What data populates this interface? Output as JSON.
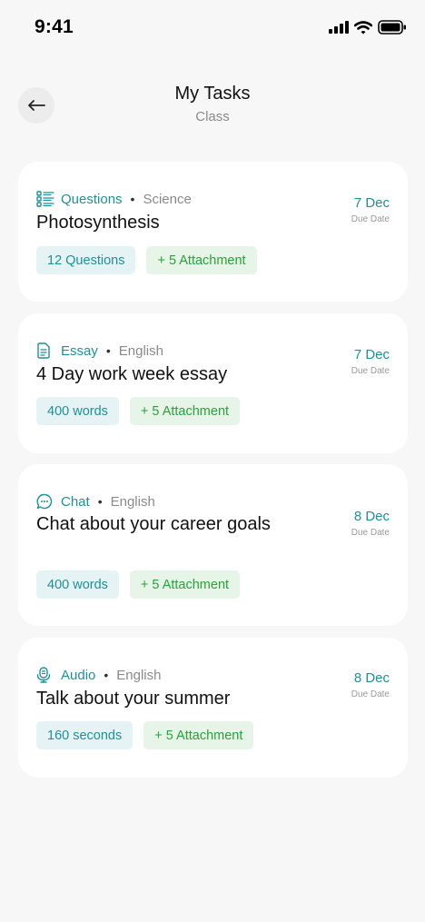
{
  "status_bar": {
    "time": "9:41"
  },
  "header": {
    "title": "My Tasks",
    "subtitle": "Class",
    "back_icon": "arrow-left-icon"
  },
  "colors": {
    "accent": "#1f8f99",
    "green": "#2aa13b",
    "muted": "#8a8a8a"
  },
  "tasks": [
    {
      "icon": "checklist-icon",
      "type": "Questions",
      "subject": "Science",
      "title": "Photosynthesis",
      "due_date": "7 Dec",
      "due_label": "Due Date",
      "count": "12 Questions",
      "attachments": "+ 5 Attachment"
    },
    {
      "icon": "document-icon",
      "type": "Essay",
      "subject": "English",
      "title": "4 Day work week essay",
      "due_date": "7 Dec",
      "due_label": "Due Date",
      "count": "400 words",
      "attachments": "+ 5 Attachment"
    },
    {
      "icon": "chat-bubble-icon",
      "type": "Chat",
      "subject": "English",
      "title": "Chat about your career goals",
      "due_date": "8 Dec",
      "due_label": "Due Date",
      "count": "400 words",
      "attachments": "+ 5 Attachment"
    },
    {
      "icon": "microphone-icon",
      "type": "Audio",
      "subject": "English",
      "title": "Talk about your summer",
      "due_date": "8 Dec",
      "due_label": "Due Date",
      "count": "160 seconds",
      "attachments": "+ 5 Attachment"
    }
  ]
}
